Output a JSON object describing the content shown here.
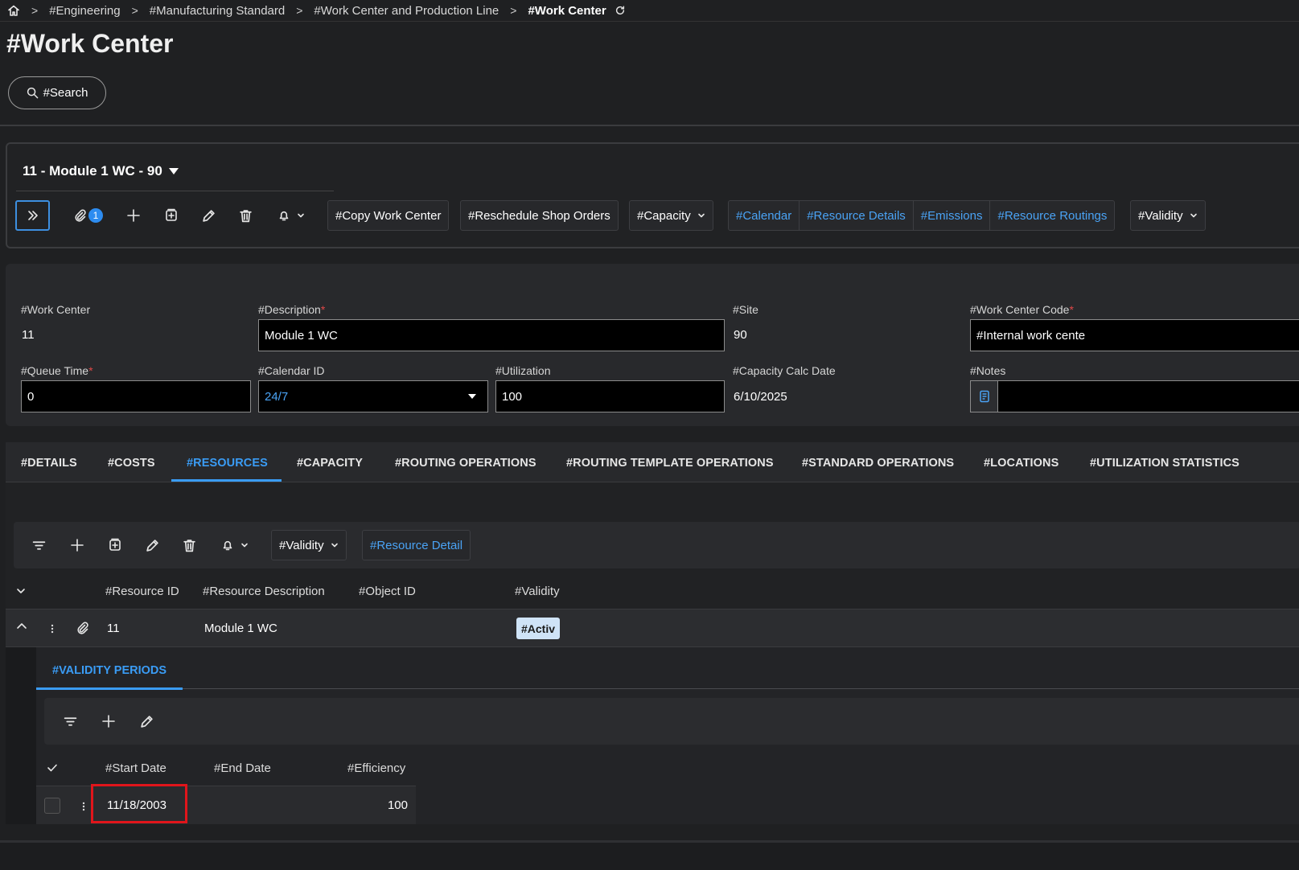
{
  "breadcrumb": {
    "items": [
      "#Engineering",
      "#Manufacturing Standard",
      "#Work Center and Production Line"
    ],
    "current": "#Work Center"
  },
  "page": {
    "title": "#Work Center"
  },
  "search": {
    "label": "#Search"
  },
  "record": {
    "title": "11 - Module 1 WC - 90"
  },
  "toolbar": {
    "attachment_count": "1",
    "copy_work_center": "#Copy Work Center",
    "reschedule_shop_orders": "#Reschedule Shop Orders",
    "capacity": "#Capacity",
    "links": [
      "#Calendar",
      "#Resource Details",
      "#Emissions",
      "#Resource Routings"
    ],
    "validity": "#Validity"
  },
  "form": {
    "work_center": {
      "label": "#Work Center",
      "value": "11"
    },
    "description": {
      "label": "#Description",
      "value": "Module 1 WC"
    },
    "site": {
      "label": "#Site",
      "value": "90"
    },
    "work_center_code": {
      "label": "#Work Center Code",
      "value": "#Internal work cente"
    },
    "queue_time": {
      "label": "#Queue Time",
      "value": "0"
    },
    "calendar_id": {
      "label": "#Calendar ID",
      "value": "24/7"
    },
    "utilization": {
      "label": "#Utilization",
      "value": "100"
    },
    "capacity_calc_date": {
      "label": "#Capacity Calc Date",
      "value": "6/10/2025"
    },
    "notes": {
      "label": "#Notes",
      "value": ""
    },
    "required_mark": "*"
  },
  "tabs": [
    "#DETAILS",
    "#COSTS",
    "#RESOURCES",
    "#CAPACITY",
    "#ROUTING OPERATIONS",
    "#ROUTING TEMPLATE OPERATIONS",
    "#STANDARD OPERATIONS",
    "#LOCATIONS",
    "#UTILIZATION STATISTICS"
  ],
  "active_tab": "#RESOURCES",
  "resources": {
    "validity": "#Validity",
    "resource_detail": "#Resource Detail",
    "columns": [
      "#Resource ID",
      "#Resource Description",
      "#Object ID",
      "#Validity"
    ],
    "rows": [
      {
        "resource_id": "11",
        "description": "Module 1 WC",
        "object_id": "",
        "validity": "#Activ"
      }
    ]
  },
  "validity_periods": {
    "tab": "#VALIDITY PERIODS",
    "columns": [
      "#Start Date",
      "#End Date",
      "#Efficiency"
    ],
    "rows": [
      {
        "start_date": "11/18/2003",
        "end_date": "",
        "efficiency": "100"
      }
    ]
  },
  "colors": {
    "accent": "#3a9cf5",
    "highlight": "#e0151b",
    "badge": "#2d8cf0",
    "required": "#e04848"
  }
}
